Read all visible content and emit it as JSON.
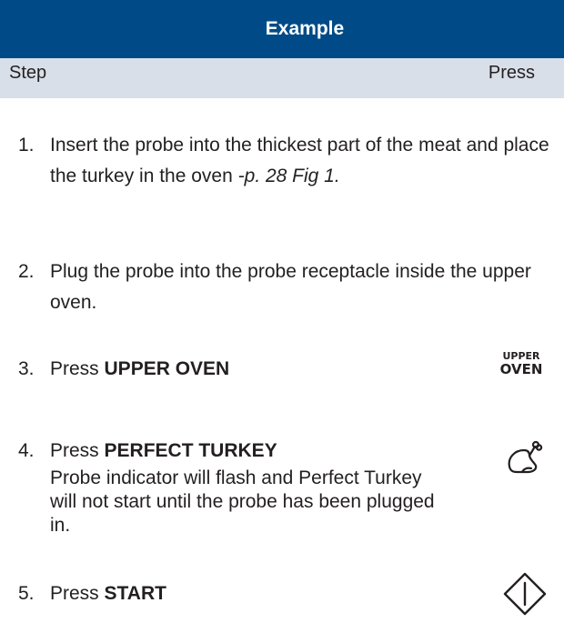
{
  "header": {
    "title": "Example"
  },
  "subheader": {
    "step_label": "Step",
    "press_label": "Press"
  },
  "steps": [
    {
      "num": "1.",
      "text": "Insert the probe into the thickest part of the meat and place the turkey in the oven ",
      "ref": "-p. 28 Fig 1."
    },
    {
      "num": "2.",
      "text": "Plug the probe into the probe receptacle inside the upper oven."
    },
    {
      "num": "3.",
      "prefix": "Press ",
      "bold": "UPPER OVEN",
      "icon": "upper-oven-button-icon",
      "icon_line1": "UPPER",
      "icon_line2": "OVEN"
    },
    {
      "num": "4.",
      "prefix": "Press ",
      "bold": "PERFECT TURKEY",
      "detail": "Probe indicator will flash and Perfect Turkey will not start until the probe has been plugged in.",
      "icon": "turkey-icon"
    },
    {
      "num": "5.",
      "prefix": "Press ",
      "bold": "START",
      "icon": "start-icon"
    }
  ]
}
